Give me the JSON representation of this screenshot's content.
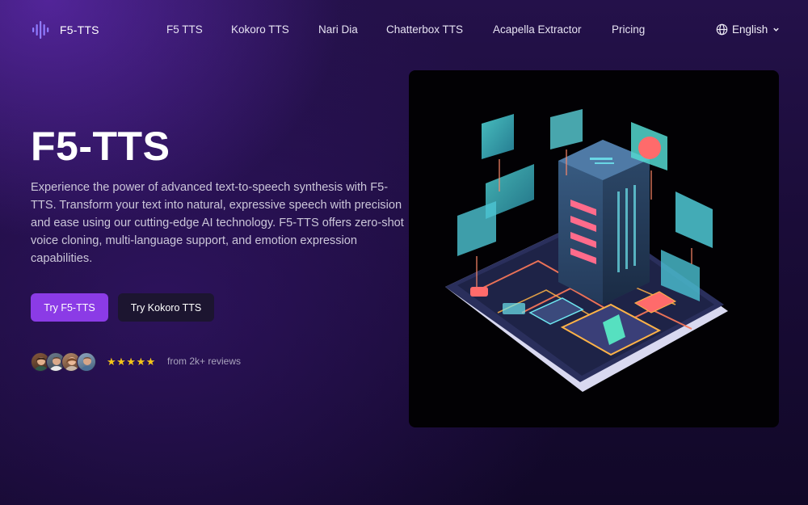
{
  "brand": {
    "name": "F5-TTS"
  },
  "nav": {
    "items": [
      {
        "label": "F5 TTS"
      },
      {
        "label": "Kokoro TTS"
      },
      {
        "label": "Nari Dia"
      },
      {
        "label": "Chatterbox TTS"
      },
      {
        "label": "Acapella Extractor"
      },
      {
        "label": "Pricing"
      }
    ],
    "language": "English"
  },
  "hero": {
    "title": "F5-TTS",
    "description": "Experience the power of advanced text-to-speech synthesis with F5-TTS. Transform your text into natural, expressive speech with precision and ease using our cutting-edge AI technology. F5-TTS offers zero-shot voice cloning, multi-language support, and emotion expression capabilities.",
    "primary_button": "Try F5-TTS",
    "secondary_button": "Try Kokoro TTS"
  },
  "reviews": {
    "stars": "★★★★★",
    "rating": 5,
    "text": "from 2k+ reviews"
  },
  "colors": {
    "accent": "#8b3be6",
    "star": "#f5c518",
    "background": "#1a0c38"
  },
  "icons": {
    "logo": "soundwave-icon",
    "language": "globe-icon",
    "dropdown": "chevron-down-icon"
  }
}
